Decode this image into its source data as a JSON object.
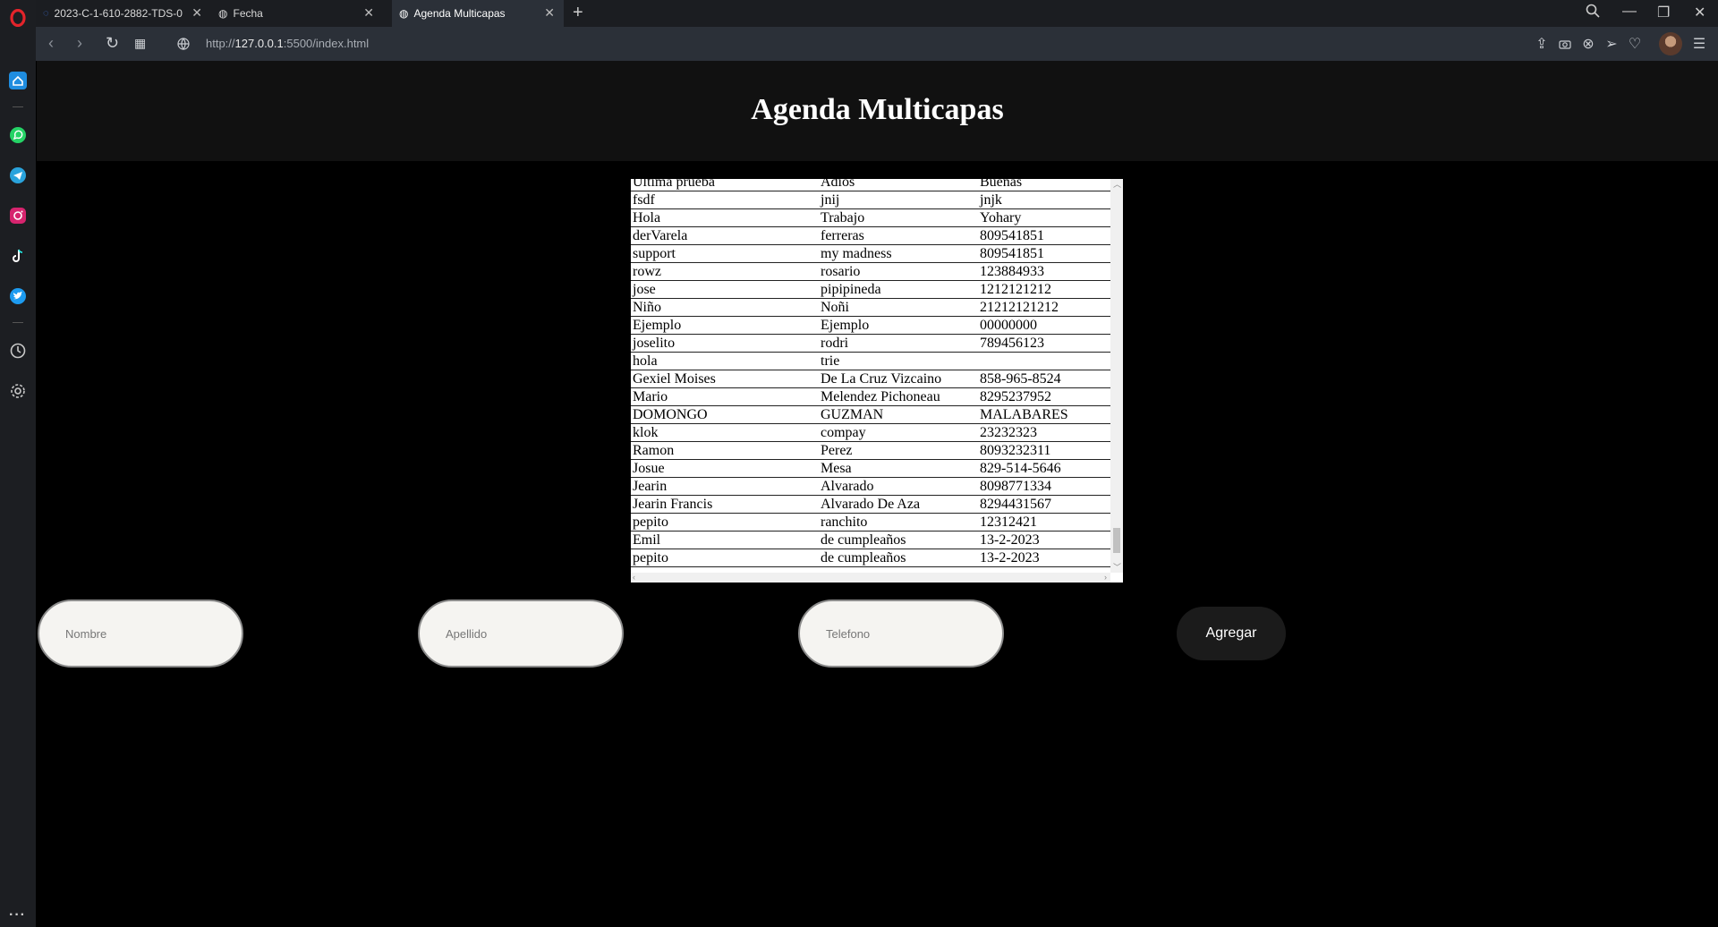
{
  "browser": {
    "tabs": [
      {
        "title": "2023-C-1-610-2882-TDS-0",
        "active": false
      },
      {
        "title": "Fecha",
        "active": false
      },
      {
        "title": "Agenda Multicapas",
        "active": true
      }
    ],
    "url_prefix": "http://",
    "url_host": "127.0.0.1",
    "url_rest": ":5500/index.html",
    "accent": "#2b3038"
  },
  "sidebar": {
    "items": [
      "home-icon",
      "whatsapp-icon",
      "telegram-icon",
      "instagram-icon",
      "tiktok-icon",
      "twitter-icon",
      "history-icon",
      "settings-icon"
    ]
  },
  "page": {
    "title": "Agenda Multicapas",
    "contacts": [
      {
        "nombre": "Ultima prueba",
        "apellido": "Adios",
        "telefono": "Buenas"
      },
      {
        "nombre": "fsdf",
        "apellido": "jnij",
        "telefono": "jnjk"
      },
      {
        "nombre": "Hola",
        "apellido": "Trabajo",
        "telefono": "Yohary"
      },
      {
        "nombre": "derVarela",
        "apellido": "ferreras",
        "telefono": "809541851"
      },
      {
        "nombre": "support",
        "apellido": "my madness",
        "telefono": "809541851"
      },
      {
        "nombre": "rowz",
        "apellido": "rosario",
        "telefono": "123884933"
      },
      {
        "nombre": "jose",
        "apellido": "pipipineda",
        "telefono": "1212121212"
      },
      {
        "nombre": "Niño",
        "apellido": "Noñi",
        "telefono": "21212121212"
      },
      {
        "nombre": "Ejemplo",
        "apellido": "Ejemplo",
        "telefono": "00000000"
      },
      {
        "nombre": "joselito",
        "apellido": "rodri",
        "telefono": "789456123"
      },
      {
        "nombre": "hola",
        "apellido": "trie",
        "telefono": ""
      },
      {
        "nombre": "Gexiel Moises",
        "apellido": "De La Cruz Vizcaino",
        "telefono": "858-965-8524"
      },
      {
        "nombre": "Mario",
        "apellido": "Melendez Pichoneau",
        "telefono": "8295237952"
      },
      {
        "nombre": "DOMONGO",
        "apellido": "GUZMAN",
        "telefono": "MALABARES"
      },
      {
        "nombre": "klok",
        "apellido": "compay",
        "telefono": "23232323"
      },
      {
        "nombre": "Ramon",
        "apellido": "Perez",
        "telefono": "8093232311"
      },
      {
        "nombre": "Josue",
        "apellido": "Mesa",
        "telefono": "829-514-5646"
      },
      {
        "nombre": "Jearin",
        "apellido": "Alvarado",
        "telefono": "8098771334"
      },
      {
        "nombre": "Jearin Francis",
        "apellido": "Alvarado De Aza",
        "telefono": "8294431567"
      },
      {
        "nombre": "pepito",
        "apellido": "ranchito",
        "telefono": "12312421"
      },
      {
        "nombre": "Emil",
        "apellido": "de cumpleaños",
        "telefono": "13-2-2023"
      },
      {
        "nombre": "pepito",
        "apellido": "de cumpleaños",
        "telefono": "13-2-2023"
      }
    ],
    "form": {
      "nombre_placeholder": "Nombre",
      "apellido_placeholder": "Apellido",
      "telefono_placeholder": "Telefono",
      "add_label": "Agregar"
    }
  }
}
